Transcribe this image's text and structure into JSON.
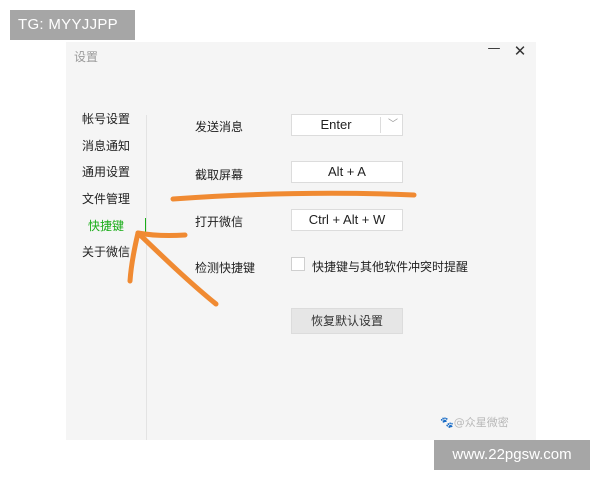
{
  "overlay": {
    "tg_label": "TG: MYYJJPP",
    "site_label": "www.22pgsw.com",
    "inner_watermark": "🐾@众星微密"
  },
  "window": {
    "title": "设置",
    "minimize_glyph": "—",
    "close_glyph": "✕"
  },
  "sidebar": {
    "items": [
      {
        "label": "帐号设置"
      },
      {
        "label": "消息通知"
      },
      {
        "label": "通用设置"
      },
      {
        "label": "文件管理"
      },
      {
        "label": "快捷键"
      },
      {
        "label": "关于微信"
      }
    ],
    "active_index": 4,
    "active_color": "#1aad19"
  },
  "shortcuts": {
    "send_message": {
      "label": "发送消息",
      "value": "Enter",
      "dropdown_icon": "chevron-down-icon",
      "chevron": "﹀"
    },
    "screenshot": {
      "label": "截取屏幕",
      "value": "Alt + A"
    },
    "open_wechat": {
      "label": "打开微信",
      "value": "Ctrl + Alt + W"
    },
    "detect": {
      "label": "检测快捷键",
      "checkbox_label": "快捷键与其他软件冲突时提醒",
      "checked": false
    },
    "restore_label": "恢复默认设置"
  },
  "annotation": {
    "color": "#f08a32"
  }
}
